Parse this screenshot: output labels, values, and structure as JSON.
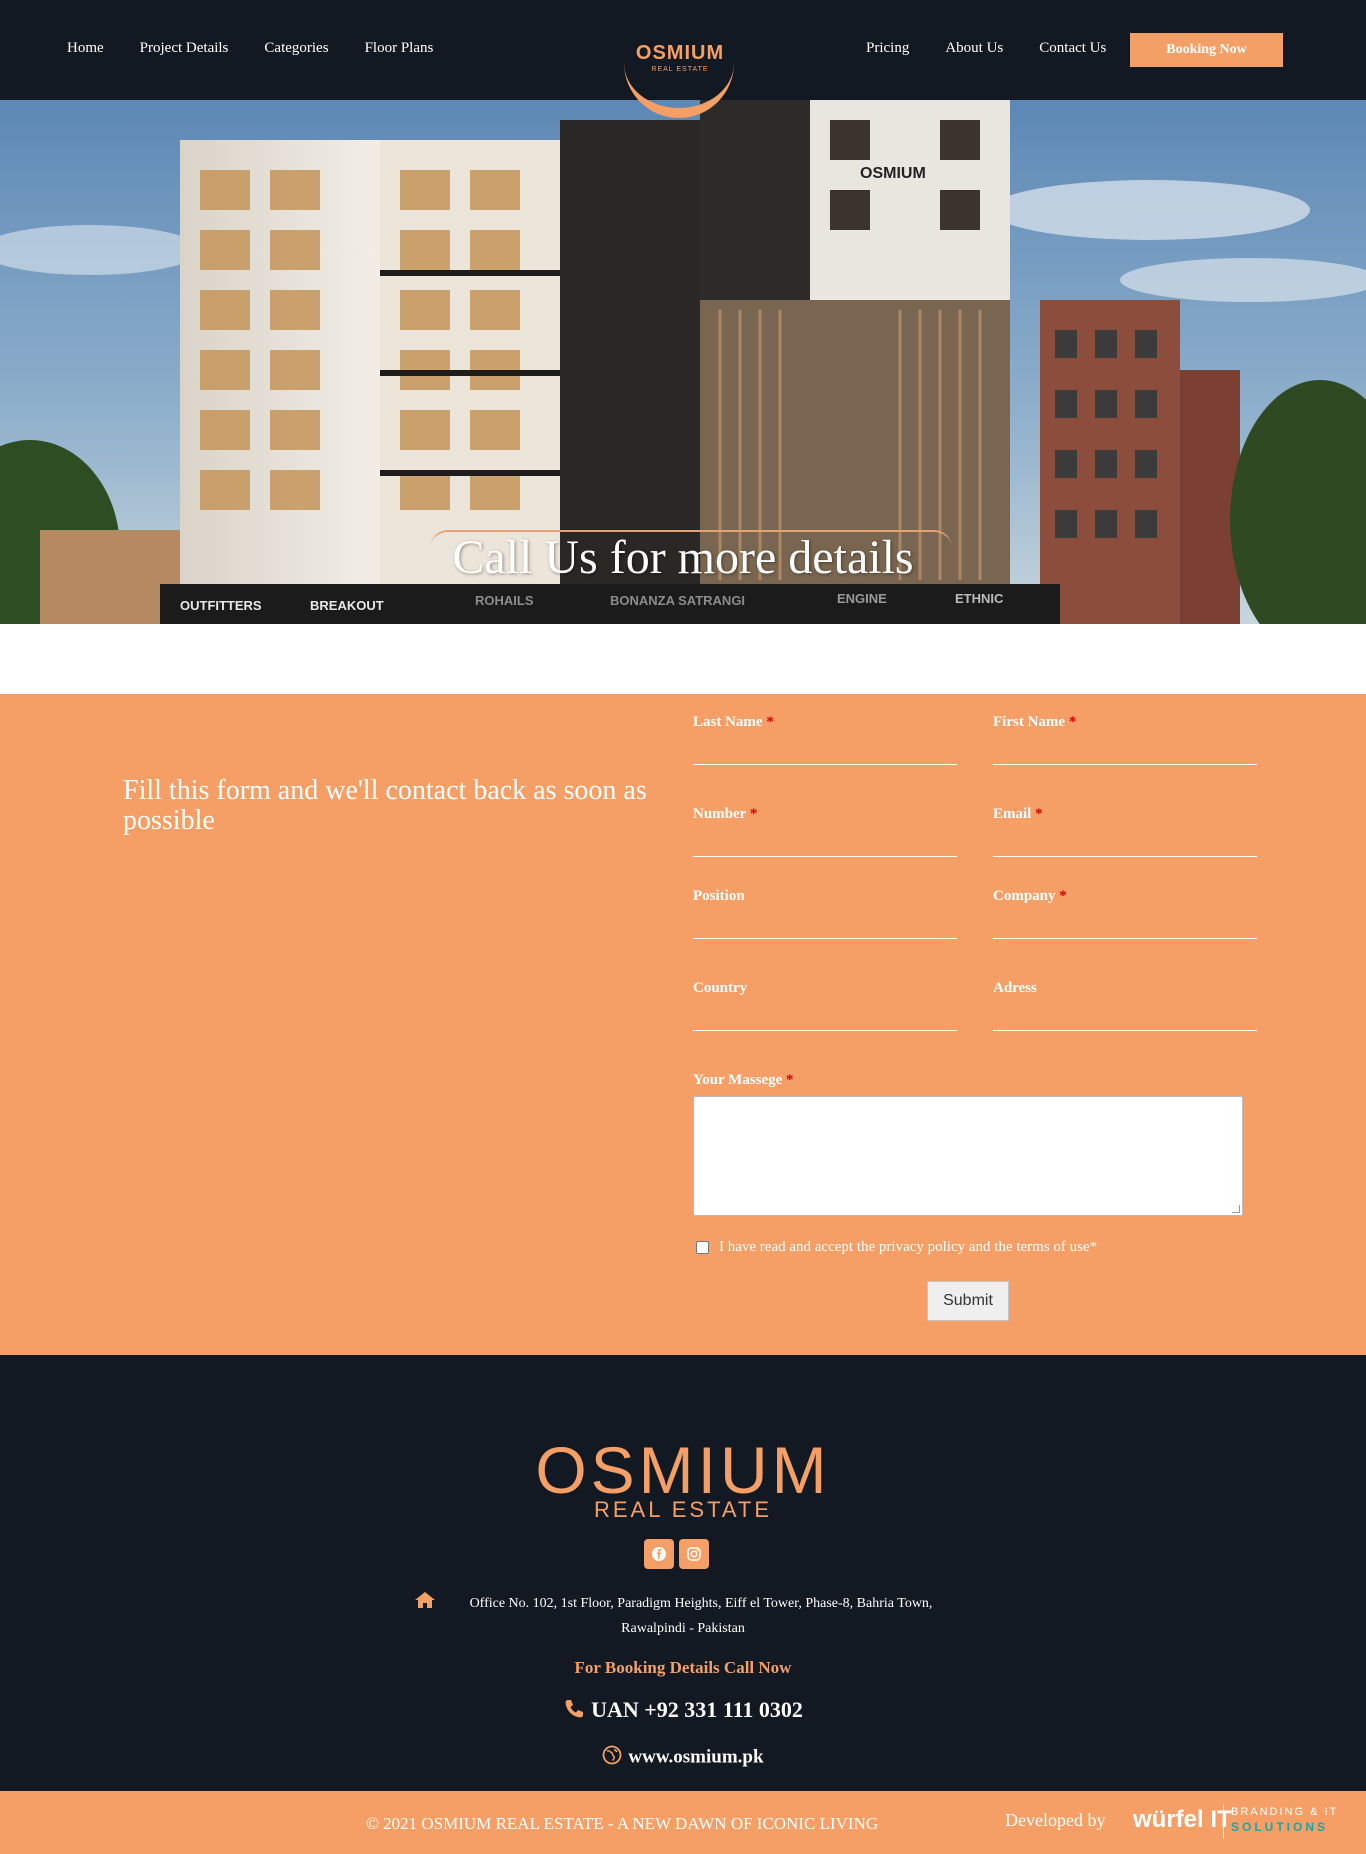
{
  "header": {
    "nav_left": [
      "Home",
      "Project Details",
      "Categories",
      "Floor Plans"
    ],
    "nav_right": [
      "Pricing",
      "About Us",
      "Contact Us"
    ],
    "cta": "Booking Now",
    "logo": {
      "name": "OSMIUM",
      "sub": "REAL ESTATE"
    }
  },
  "hero": {
    "title": "Call Us for more details",
    "shop_signs": [
      "OUTFITTERS",
      "BREAKOUT",
      "ROHAILS",
      "BONANZA SATRANGI",
      "ENGINE",
      "ETHNIC"
    ],
    "building_sign": "OSMIUM"
  },
  "form": {
    "intro": "Fill this form and we'll contact back as soon as possible",
    "fields": [
      {
        "label": "Last Name",
        "required": "*"
      },
      {
        "label": "First Name",
        "required": "*"
      },
      {
        "label": "Number",
        "required": "*"
      },
      {
        "label": "Email",
        "required": "*"
      },
      {
        "label": "Position",
        "required": ""
      },
      {
        "label": "Company",
        "required": "*"
      },
      {
        "label": "Country",
        "required": ""
      },
      {
        "label": "Adress",
        "required": ""
      }
    ],
    "message_label": "Your Massege",
    "message_required": "*",
    "consent": "I have read and accept the privacy policy and the terms of use*",
    "submit": "Submit"
  },
  "footer": {
    "logo": "OSMIUM",
    "logo_sub": "REAL ESTATE",
    "social": [
      "facebook-icon",
      "instagram-icon"
    ],
    "address_line1": "Office No. 102, 1st Floor, Paradigm Heights, Eiff el Tower, Phase-8, Bahria Town,",
    "address_line2": "Rawalpindi - Pakistan",
    "booking": "For Booking Details Call Now",
    "phone": "UAN +92 331 111 0302",
    "website": "www.osmium.pk"
  },
  "bottom": {
    "copyright": "© 2021 OSMIUM REAL ESTATE - A NEW DAWN OF ICONIC LIVING",
    "developed_by": "Developed by",
    "dev_brand": "würfel IT",
    "dev_tag1": "BRANDING & IT",
    "dev_tag2": "SOLUTIONS"
  },
  "colors": {
    "accent": "#f59f66",
    "dark": "#131922",
    "required": "#d40000"
  }
}
